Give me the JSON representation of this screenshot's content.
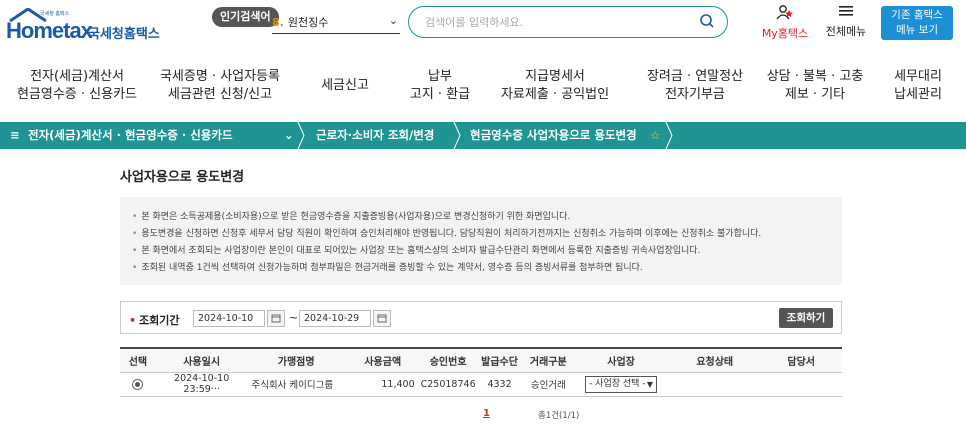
{
  "header": {
    "logo_small": "국세청 홈택스",
    "logo_word": "Hometax",
    "logo_kr": "국세청홈택스",
    "popular_label": "인기검색어",
    "popular_rank": "8.",
    "popular_term": "원천징수",
    "search_placeholder": "검색어를 입력하세요.",
    "my_label": "My홈택스",
    "all_menu_label": "전체메뉴",
    "old_tax_line1": "기존 홈택스",
    "old_tax_line2": "메뉴 보기"
  },
  "gnb": [
    {
      "l1": "전자(세금)계산서",
      "l2": "현금영수증 · 신용카드"
    },
    {
      "l1": "국세증명 · 사업자등록",
      "l2": "세금관련 신청/신고"
    },
    {
      "l1": "세금신고",
      "l2": ""
    },
    {
      "l1": "납부",
      "l2": "고지 · 환급"
    },
    {
      "l1": "지급명세서",
      "l2": "자료제출 · 공익법인"
    },
    {
      "l1": "장려금 · 연말정산",
      "l2": "전자기부금"
    },
    {
      "l1": "상담 · 불복 · 고충",
      "l2": "제보 · 기타"
    },
    {
      "l1": "세무대리",
      "l2": "납세관리"
    }
  ],
  "breadcrumb": {
    "menu_icon": "≡",
    "level1": "전자(세금)계산서 · 현금영수증 · 신용카드",
    "level2": "근로자·소비자 조회/변경",
    "level3": "현금영수증 사업자용으로 용도변경",
    "star": "☆"
  },
  "page": {
    "title": "사업자용으로 용도변경",
    "notices": [
      "본 화면은 소득공제용(소비자용)으로 받은 현금영수증을 지출증빙용(사업자용)으로 변경신청하기 위한 화면입니다.",
      "용도변경을 신청하면 신청후 세무서 담당 직원이 확인하여 승인처리해야 반영됩니다. 담당직원이 처리하기전까지는 신청취소 가능하며 이후에는 신청취소 불가합니다.",
      "본 화면에서 조회되는 사업장이란 본인이 대표로 되어있는 사업장 또는 홈택스상의 소비자 발급수단관리 화면에서 등록한 지출증빙 귀속사업장입니다.",
      "조회된 내역중 1건씩 선택하여 신청가능하며 첨부파일은 현금거래를 증빙할 수 있는 계약서, 영수증 등의 증빙서류를 첨부하면 됩니다."
    ]
  },
  "filter": {
    "label": "조회기간",
    "required_mark": "•",
    "from": "2024-10-10",
    "to": "2024-10-29",
    "tilde": "~",
    "query_button": "조회하기"
  },
  "table": {
    "headers": [
      "선택",
      "사용일시",
      "가맹점명",
      "사용금액",
      "승인번호",
      "발급수단",
      "거래구분",
      "사업장",
      "요청상태",
      "담당서"
    ],
    "rows": [
      {
        "datetime": "2024-10-10 23:59···",
        "merchant": "주식회사 케이디그룹",
        "amount": "11,400",
        "approval": "C25018746",
        "issue_means": "4332",
        "trade_type": "승인거래",
        "workplace": "- 사업장 선택 -",
        "status": "",
        "office": ""
      }
    ]
  },
  "pager": {
    "current": "1",
    "count_text": "총1건(1/1)"
  }
}
